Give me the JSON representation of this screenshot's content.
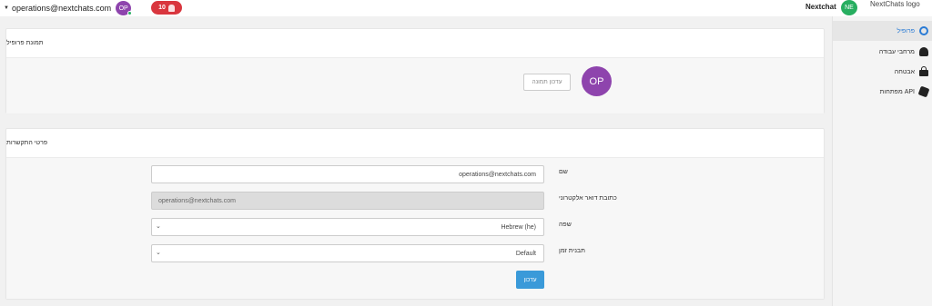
{
  "topbar": {
    "user_email": "operations@nextchats.com",
    "user_initials": "OP",
    "notifications_count": "10",
    "brand_name": "Nextchat",
    "brand_initials": "NE",
    "logo_alt": "NextChats logo"
  },
  "sidebar": {
    "items": [
      {
        "label": "פרופיל",
        "icon": "user-icon",
        "active": true
      },
      {
        "label": "מרחבי עבודה",
        "icon": "users-icon"
      },
      {
        "label": "אבטחה",
        "icon": "lock-icon"
      },
      {
        "label": "מפתחות API",
        "icon": "puzzle-icon"
      }
    ]
  },
  "profile_photo": {
    "title": "תמונת פרופיל",
    "avatar_initials": "OP",
    "update_photo_label": "עדכון תמונה"
  },
  "contact": {
    "title": "פרטי התקשרות",
    "name_label": "שם",
    "name_value": "operations@nextchats.com",
    "email_label": "כתובת דואר אלקטרוני",
    "email_value": "operations@nextchats.com",
    "language_label": "שפה",
    "language_value": "Hebrew (he)",
    "timezone_label": "תבנית זמן",
    "timezone_value": "Default",
    "update_label": "עדכון"
  },
  "colors": {
    "accent": "#3a9ad9",
    "badge": "#d9363e",
    "user_avatar": "#8e44ad",
    "brand_avatar": "#27ae60"
  }
}
